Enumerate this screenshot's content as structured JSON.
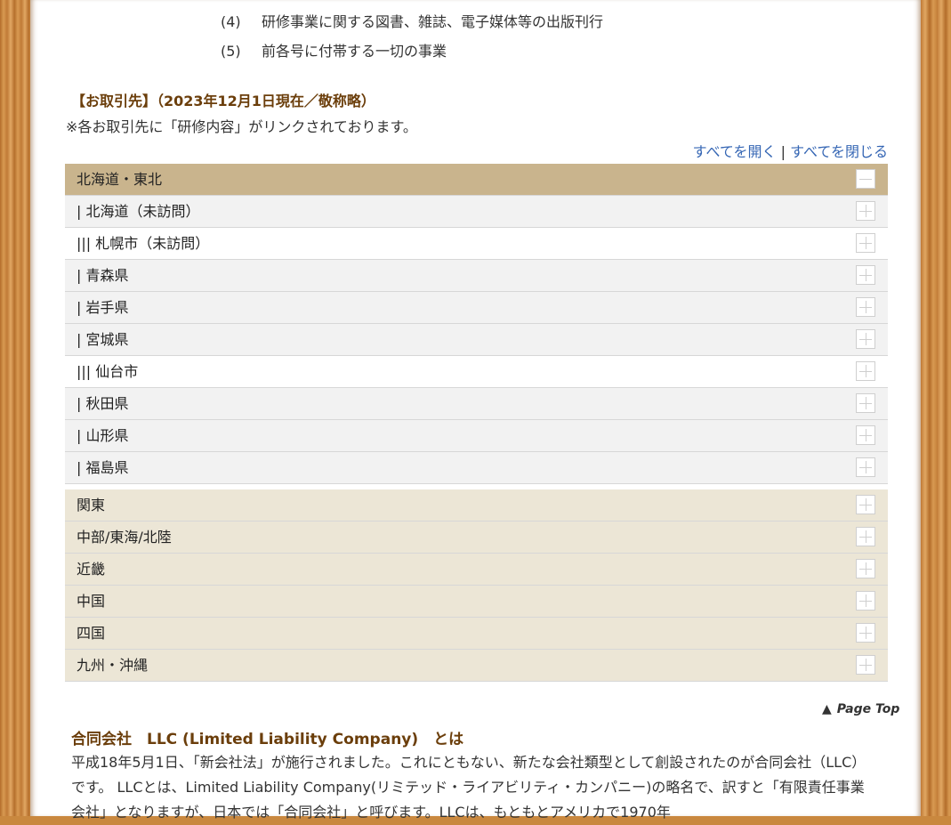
{
  "business_list": [
    {
      "num": "(4)",
      "text": "研修事業に関する図書、雑誌、電子媒体等の出版刊行"
    },
    {
      "num": "(5)",
      "text": "前各号に付帯する一切の事業"
    }
  ],
  "clients": {
    "heading": "【お取引先】（2023年12月1日現在／敬称略）",
    "note": "※各お取引先に「研修内容」がリンクされております。",
    "open_all": "すべてを開く",
    "separator": "|",
    "close_all": "すべてを閉じる"
  },
  "accordion_open": {
    "title": "北海道・東北",
    "items": [
      {
        "label": "| 北海道（未訪問）",
        "style": "gray"
      },
      {
        "label": "||| 札幌市（未訪問）",
        "style": "white"
      },
      {
        "label": "| 青森県",
        "style": "gray"
      },
      {
        "label": "| 岩手県",
        "style": "gray"
      },
      {
        "label": "| 宮城県",
        "style": "gray"
      },
      {
        "label": "||| 仙台市",
        "style": "white"
      },
      {
        "label": "| 秋田県",
        "style": "gray"
      },
      {
        "label": "| 山形県",
        "style": "gray"
      },
      {
        "label": "| 福島県",
        "style": "gray"
      }
    ]
  },
  "accordion_closed": [
    "関東",
    "中部/東海/北陸",
    "近畿",
    "中国",
    "四国",
    "九州・沖縄"
  ],
  "page_top": "Page Top",
  "llc": {
    "title": "合同会社　LLC (Limited Liability Company)　とは",
    "body": "平成18年5月1日、「新会社法」が施行されました。これにともない、新たな会社類型として創設されたのが合同会社（LLC）です。 LLCとは、Limited Liability Company(リミテッド・ライアビリティ・カンパニー)の略名で、訳すと「有限責任事業会社」となりますが、日本では「合同会社」と呼びます。LLCは、もともとアメリカで1970年"
  },
  "colors": {
    "heading": "#6b3e0b",
    "link": "#3566b4",
    "open_header": "#c9b48d",
    "region_row": "#ece6d6"
  }
}
